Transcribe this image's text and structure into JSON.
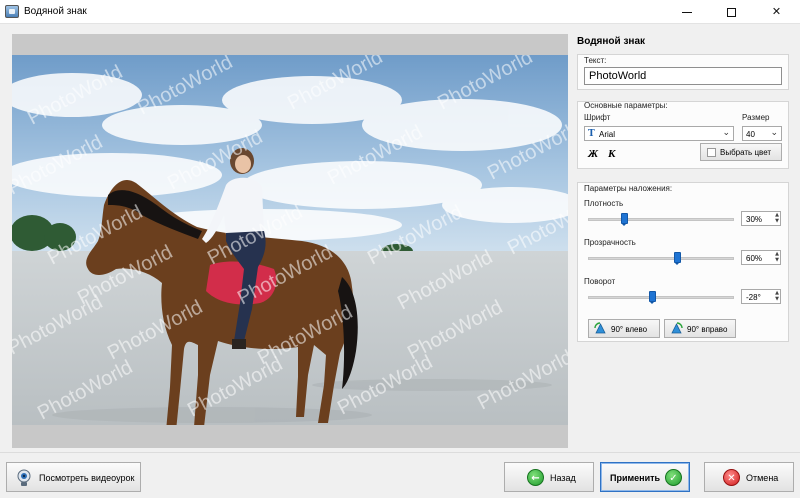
{
  "window": {
    "title": "Водяной знак",
    "icon": "app-photo-icon",
    "controls": [
      "minimize",
      "maximize",
      "close"
    ]
  },
  "preview": {
    "watermark_text": "PhotoWorld"
  },
  "panel": {
    "title": "Водяной знак",
    "text_group": {
      "label": "Текст:",
      "value": "PhotoWorld"
    },
    "basic_group": {
      "label": "Основные параметры:",
      "font_label": "Шрифт",
      "font_value": "Arial",
      "size_label": "Размер",
      "size_value": "40",
      "bold_label": "Ж",
      "italic_label": "К",
      "color_button": "Выбрать цвет"
    },
    "overlay_group": {
      "label": "Параметры наложения:",
      "density_label": "Плотность",
      "density_value": "30%",
      "transparency_label": "Прозрачность",
      "transparency_value": "60%",
      "rotation_label": "Поворот",
      "rotation_value": "-28°",
      "density_level": 0.25,
      "transparency_level": 0.61,
      "rotation_level": 0.44,
      "rotate_left": "90° влево",
      "rotate_right": "90° вправо"
    }
  },
  "footer": {
    "tutorial_button": "Посмотреть видеоурок",
    "back_button": "Назад",
    "apply_button": "Применить",
    "cancel_button": "Отмена"
  },
  "colors": {
    "accent_blue": "#1f74d3",
    "ok_green": "#1e9a2c",
    "cancel_red": "#d11b1b",
    "back_green": "#2aa33a"
  }
}
